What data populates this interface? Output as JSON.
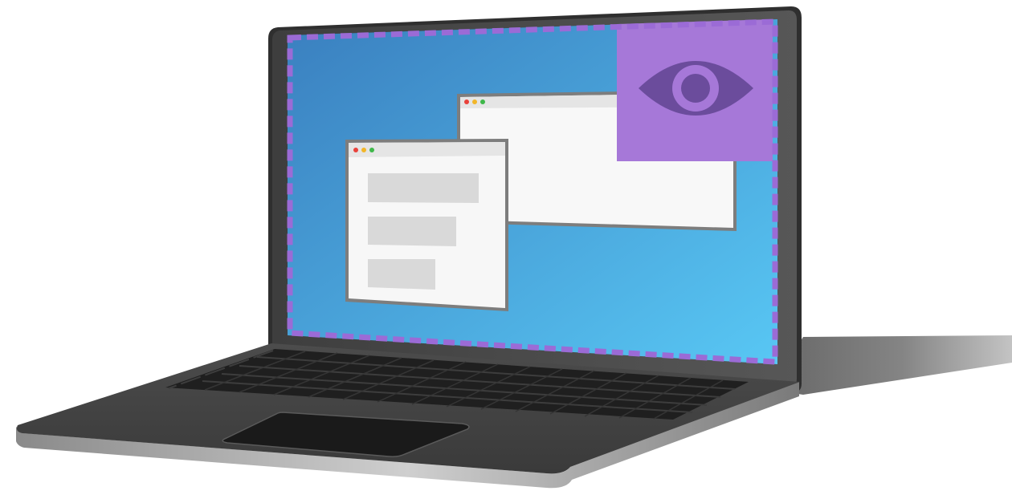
{
  "illustration": {
    "subject": "laptop-screen-recording",
    "icon_names": [
      "eye-icon"
    ],
    "colors": {
      "background": "#ffffff",
      "shadow": "#6b6b6b",
      "laptop_lid": "#4a4a4a",
      "laptop_lid_edge": "#2e2e2e",
      "laptop_base": "#444444",
      "keyboard": "#1e1e1e",
      "trackpad": "#1a1a1a",
      "screen_gradient_start": "#3a82c0",
      "screen_gradient_end": "#5ac8f5",
      "capture_border_dash": "#9b6bd6",
      "capture_badge": "#a678d8",
      "eye_icon": "#6a4a9a",
      "window_frame": "#7d7d7d",
      "window_titlebar": "#e6e6e6",
      "window_body": "#f7f7f7",
      "window_placeholder": "#d9d9d9",
      "dot_red": "#e9423b",
      "dot_yellow": "#f2b629",
      "dot_green": "#3fb84a"
    }
  }
}
